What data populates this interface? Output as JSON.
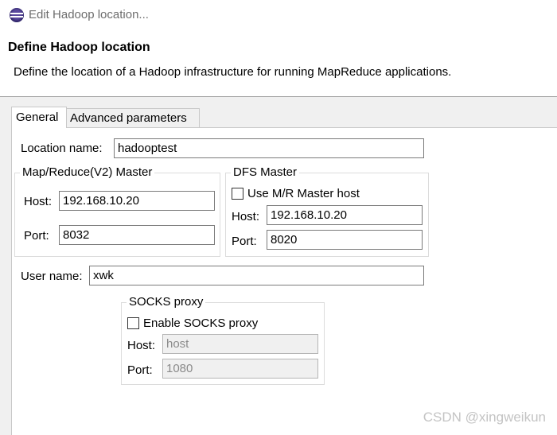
{
  "window": {
    "title": "Edit Hadoop location..."
  },
  "header": {
    "title": "Define Hadoop location",
    "description": "Define the location of a Hadoop infrastructure for running MapReduce applications."
  },
  "tabs": [
    {
      "label": "General",
      "selected": true
    },
    {
      "label": "Advanced parameters",
      "selected": false
    }
  ],
  "general": {
    "location_name_label": "Location name:",
    "location_name_value": "hadooptest",
    "mr_master": {
      "title": "Map/Reduce(V2) Master",
      "host_label": "Host:",
      "host_value": "192.168.10.20",
      "port_label": "Port:",
      "port_value": "8032"
    },
    "dfs_master": {
      "title": "DFS Master",
      "use_mr_host_label": "Use M/R Master host",
      "use_mr_host_checked": false,
      "host_label": "Host:",
      "host_value": "192.168.10.20",
      "port_label": "Port:",
      "port_value": "8020"
    },
    "user_name_label": "User name:",
    "user_name_value": "xwk",
    "socks_proxy": {
      "title": "SOCKS proxy",
      "enable_label": "Enable SOCKS proxy",
      "enable_checked": false,
      "host_label": "Host:",
      "host_value": "host",
      "port_label": "Port:",
      "port_value": "1080"
    }
  },
  "watermark": "CSDN @xingweikun"
}
